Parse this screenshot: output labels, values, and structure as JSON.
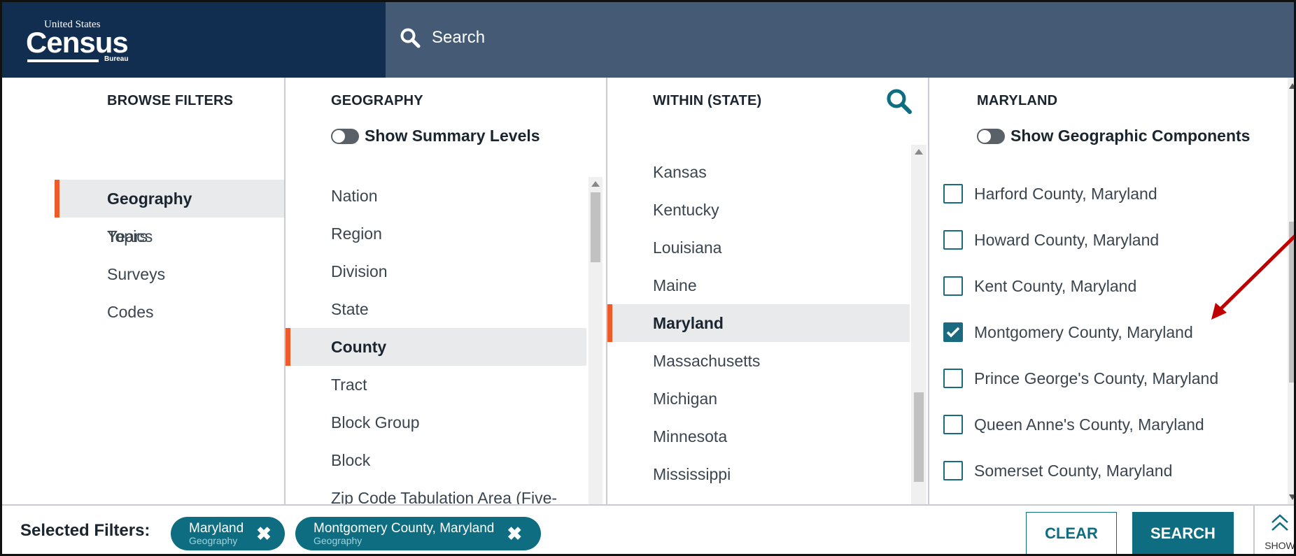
{
  "header": {
    "logo": {
      "small": "United States",
      "big": "Census",
      "bureau": "Bureau"
    },
    "search_placeholder": "Search"
  },
  "browse": {
    "title": "BROWSE FILTERS",
    "items": [
      {
        "label": "Topics",
        "active": false
      },
      {
        "label": "Geography",
        "active": true
      },
      {
        "label": "Years",
        "active": false
      },
      {
        "label": "Surveys",
        "active": false
      },
      {
        "label": "Codes",
        "active": false
      }
    ]
  },
  "geography": {
    "title": "GEOGRAPHY",
    "toggle_label": "Show Summary Levels",
    "items": [
      {
        "label": "Nation",
        "active": false
      },
      {
        "label": "Region",
        "active": false
      },
      {
        "label": "Division",
        "active": false
      },
      {
        "label": "State",
        "active": false
      },
      {
        "label": "County",
        "active": true
      },
      {
        "label": "Tract",
        "active": false
      },
      {
        "label": "Block Group",
        "active": false
      },
      {
        "label": "Block",
        "active": false
      },
      {
        "label": "Zip Code Tabulation Area (Five-",
        "active": false
      }
    ]
  },
  "within": {
    "title": "WITHIN (STATE)",
    "items": [
      {
        "label": "Kansas",
        "active": false
      },
      {
        "label": "Kentucky",
        "active": false
      },
      {
        "label": "Louisiana",
        "active": false
      },
      {
        "label": "Maine",
        "active": false
      },
      {
        "label": "Maryland",
        "active": true
      },
      {
        "label": "Massachusetts",
        "active": false
      },
      {
        "label": "Michigan",
        "active": false
      },
      {
        "label": "Minnesota",
        "active": false
      },
      {
        "label": "Mississippi",
        "active": false
      }
    ]
  },
  "maryland": {
    "title": "MARYLAND",
    "toggle_label": "Show Geographic Components",
    "items": [
      {
        "label": "Harford County, Maryland",
        "checked": false
      },
      {
        "label": "Howard County, Maryland",
        "checked": false
      },
      {
        "label": "Kent County, Maryland",
        "checked": false
      },
      {
        "label": "Montgomery County, Maryland",
        "checked": true
      },
      {
        "label": "Prince George's County, Maryland",
        "checked": false
      },
      {
        "label": "Queen Anne's County, Maryland",
        "checked": false
      },
      {
        "label": "Somerset County, Maryland",
        "checked": false
      }
    ]
  },
  "footer": {
    "selected_label": "Selected Filters:",
    "chips": [
      {
        "main": "Maryland",
        "sub": "Geography"
      },
      {
        "main": "Montgomery County, Maryland",
        "sub": "Geography"
      }
    ],
    "clear_label": "CLEAR",
    "search_label": "SEARCH",
    "show_label": "SHOW"
  },
  "colors": {
    "header_dark": "#112e51",
    "header": "#445a75",
    "accent": "#f05a28",
    "teal": "#0e6d80",
    "annotation_arrow": "#c00000"
  }
}
